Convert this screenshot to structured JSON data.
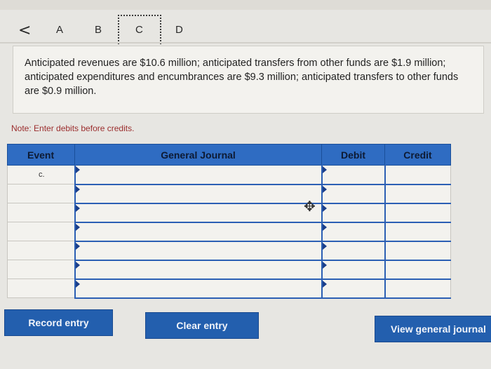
{
  "header": {
    "back_symbol": "<",
    "tabs": [
      {
        "label": "A"
      },
      {
        "label": "B"
      },
      {
        "label": "C"
      },
      {
        "label": "D"
      }
    ],
    "selected_tab": "C"
  },
  "problem": {
    "text": "Anticipated revenues are $10.6 million; anticipated transfers from other funds are $1.9 million; anticipated expenditures and encumbrances are $9.3 million; anticipated transfers to other funds are $0.9 million."
  },
  "note": "Note: Enter debits before credits.",
  "table": {
    "headers": {
      "event": "Event",
      "general_journal": "General Journal",
      "debit": "Debit",
      "credit": "Credit"
    },
    "rows": [
      {
        "event": "c.",
        "account": "",
        "debit": "",
        "credit": ""
      },
      {
        "event": "",
        "account": "",
        "debit": "",
        "credit": ""
      },
      {
        "event": "",
        "account": "",
        "debit": "",
        "credit": ""
      },
      {
        "event": "",
        "account": "",
        "debit": "",
        "credit": ""
      },
      {
        "event": "",
        "account": "",
        "debit": "",
        "credit": ""
      },
      {
        "event": "",
        "account": "",
        "debit": "",
        "credit": ""
      },
      {
        "event": "",
        "account": "",
        "debit": "",
        "credit": ""
      }
    ]
  },
  "buttons": {
    "record": "Record entry",
    "clear": "Clear entry",
    "view": "View general journal"
  },
  "colors": {
    "accent": "#2f6cc2",
    "button": "#235fae",
    "note_text": "#9b2d2d",
    "background": "#e7e6e2"
  }
}
